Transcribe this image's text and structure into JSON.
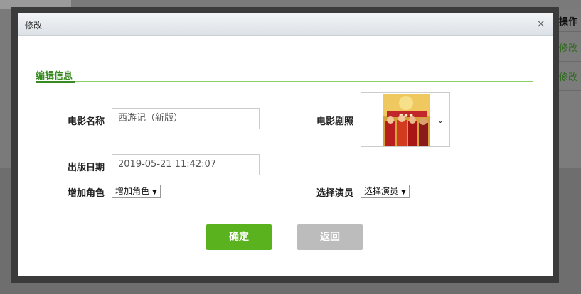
{
  "background": {
    "column_header": "操作",
    "row_links": [
      "修改",
      "修改"
    ]
  },
  "modal": {
    "title": "修改",
    "close_symbol": "×",
    "section_tab": "编辑信息"
  },
  "form": {
    "movie_name": {
      "label": "电影名称",
      "value": "西游记（新版）"
    },
    "release_date": {
      "label": "出版日期",
      "value": "2019-05-21 11:42:07"
    },
    "add_role": {
      "label": "增加角色",
      "selected": "增加角色"
    },
    "movie_still": {
      "label": "电影剧照",
      "chevron": "⌄"
    },
    "select_actor": {
      "label": "选择演员",
      "selected": "选择演员"
    }
  },
  "buttons": {
    "confirm": "确定",
    "back": "返回"
  },
  "icons": {
    "close": "close-icon",
    "dropdown": "chevron-down-icon"
  },
  "colors": {
    "accent_green": "#3a8a22",
    "confirm_button": "#5ab21f",
    "back_button": "#bcbcbc"
  }
}
